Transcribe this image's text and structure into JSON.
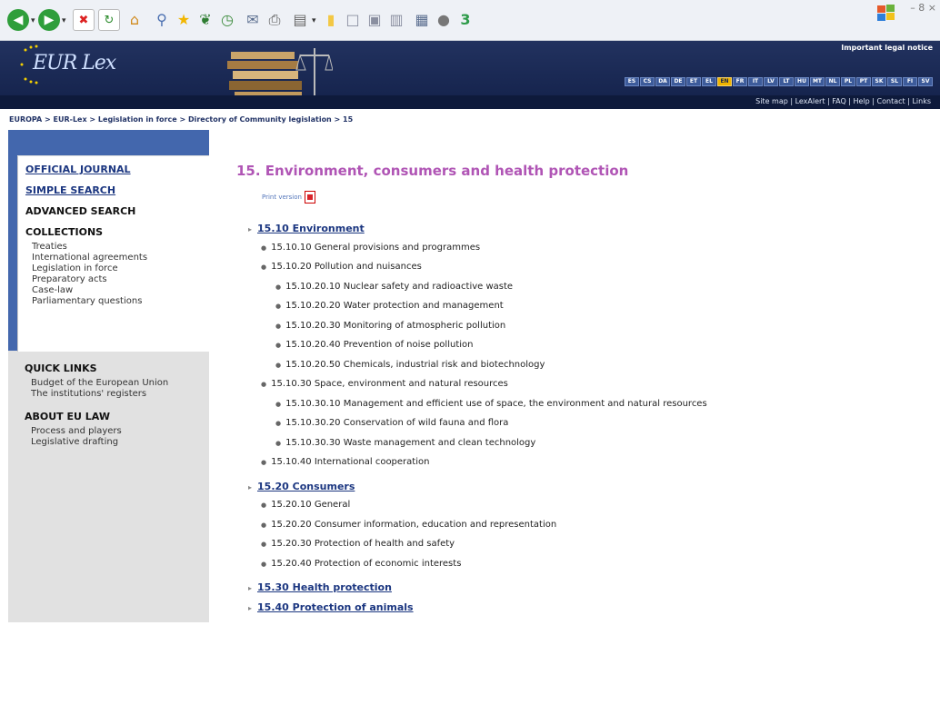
{
  "toolbar": {
    "icons": [
      "back-icon",
      "forward-icon",
      "stop-icon",
      "refresh-icon",
      "home-icon",
      "search-icon",
      "favorites-icon",
      "media-icon",
      "history-icon",
      "mail-icon",
      "print-icon",
      "edit-icon",
      "folder-icon",
      "page-icon",
      "page-icon-2",
      "page-icon-3",
      "research-icon",
      "messenger-icon",
      "tool-icon"
    ],
    "window_controls": "– 8 ×"
  },
  "banner": {
    "logo_text": "EUR Lex",
    "legal_notice": "Important legal notice",
    "languages": [
      "ES",
      "CS",
      "DA",
      "DE",
      "ET",
      "EL",
      "EN",
      "FR",
      "IT",
      "LV",
      "LT",
      "HU",
      "MT",
      "NL",
      "PL",
      "PT",
      "SK",
      "SL",
      "FI",
      "SV"
    ],
    "active_language": "EN",
    "util_links": "Site map | LexAlert | FAQ | Help | Contact | Links"
  },
  "breadcrumb": "EUROPA > EUR-Lex > Legislation in force > Directory of Community legislation > 15",
  "sidebar": {
    "official_journal": "OFFICIAL JOURNAL",
    "simple_search": "SIMPLE SEARCH",
    "advanced_search": "ADVANCED SEARCH",
    "collections_title": "COLLECTIONS",
    "collections": [
      "Treaties",
      "International agreements",
      "Legislation in force",
      "Preparatory acts",
      "Case-law",
      "Parliamentary questions"
    ],
    "quick_links_title": "QUICK LINKS",
    "quick_links": [
      "Budget of the European Union",
      "The institutions' registers"
    ],
    "about_title": "ABOUT EU LAW",
    "about_links": [
      "Process and players",
      "Legislative drafting"
    ]
  },
  "main": {
    "title": "15. Environment, consumers and health protection",
    "print_version": "Print version",
    "tree": [
      {
        "level": 1,
        "text": "15.10 Environment"
      },
      {
        "level": 2,
        "text": "15.10.10 General provisions and programmes"
      },
      {
        "level": 2,
        "text": "15.10.20 Pollution and nuisances"
      },
      {
        "level": 3,
        "text": "15.10.20.10 Nuclear safety and radioactive waste"
      },
      {
        "level": 3,
        "text": "15.10.20.20 Water protection and management"
      },
      {
        "level": 3,
        "text": "15.10.20.30 Monitoring of atmospheric pollution"
      },
      {
        "level": 3,
        "text": "15.10.20.40 Prevention of noise pollution"
      },
      {
        "level": 3,
        "text": "15.10.20.50 Chemicals, industrial risk and biotechnology"
      },
      {
        "level": 2,
        "text": "15.10.30 Space, environment and natural resources"
      },
      {
        "level": 3,
        "text": "15.10.30.10 Management and efficient use of space, the environment and natural resources"
      },
      {
        "level": 3,
        "text": "15.10.30.20 Conservation of wild fauna and flora"
      },
      {
        "level": 3,
        "text": "15.10.30.30 Waste management and clean technology"
      },
      {
        "level": 2,
        "text": "15.10.40 International cooperation"
      },
      {
        "level": 1,
        "text": "15.20 Consumers"
      },
      {
        "level": 2,
        "text": "15.20.10 General"
      },
      {
        "level": 2,
        "text": "15.20.20 Consumer information, education and representation"
      },
      {
        "level": 2,
        "text": "15.20.30 Protection of health and safety"
      },
      {
        "level": 2,
        "text": "15.20.40 Protection of economic interests"
      },
      {
        "level": 1,
        "text": "15.30 Health protection"
      },
      {
        "level": 1,
        "text": "15.40 Protection of animals"
      }
    ]
  },
  "colors": {
    "banner": "#13214a",
    "title": "#b055b5",
    "link": "#1b3680",
    "sidebar_accent": "#4367ad"
  }
}
